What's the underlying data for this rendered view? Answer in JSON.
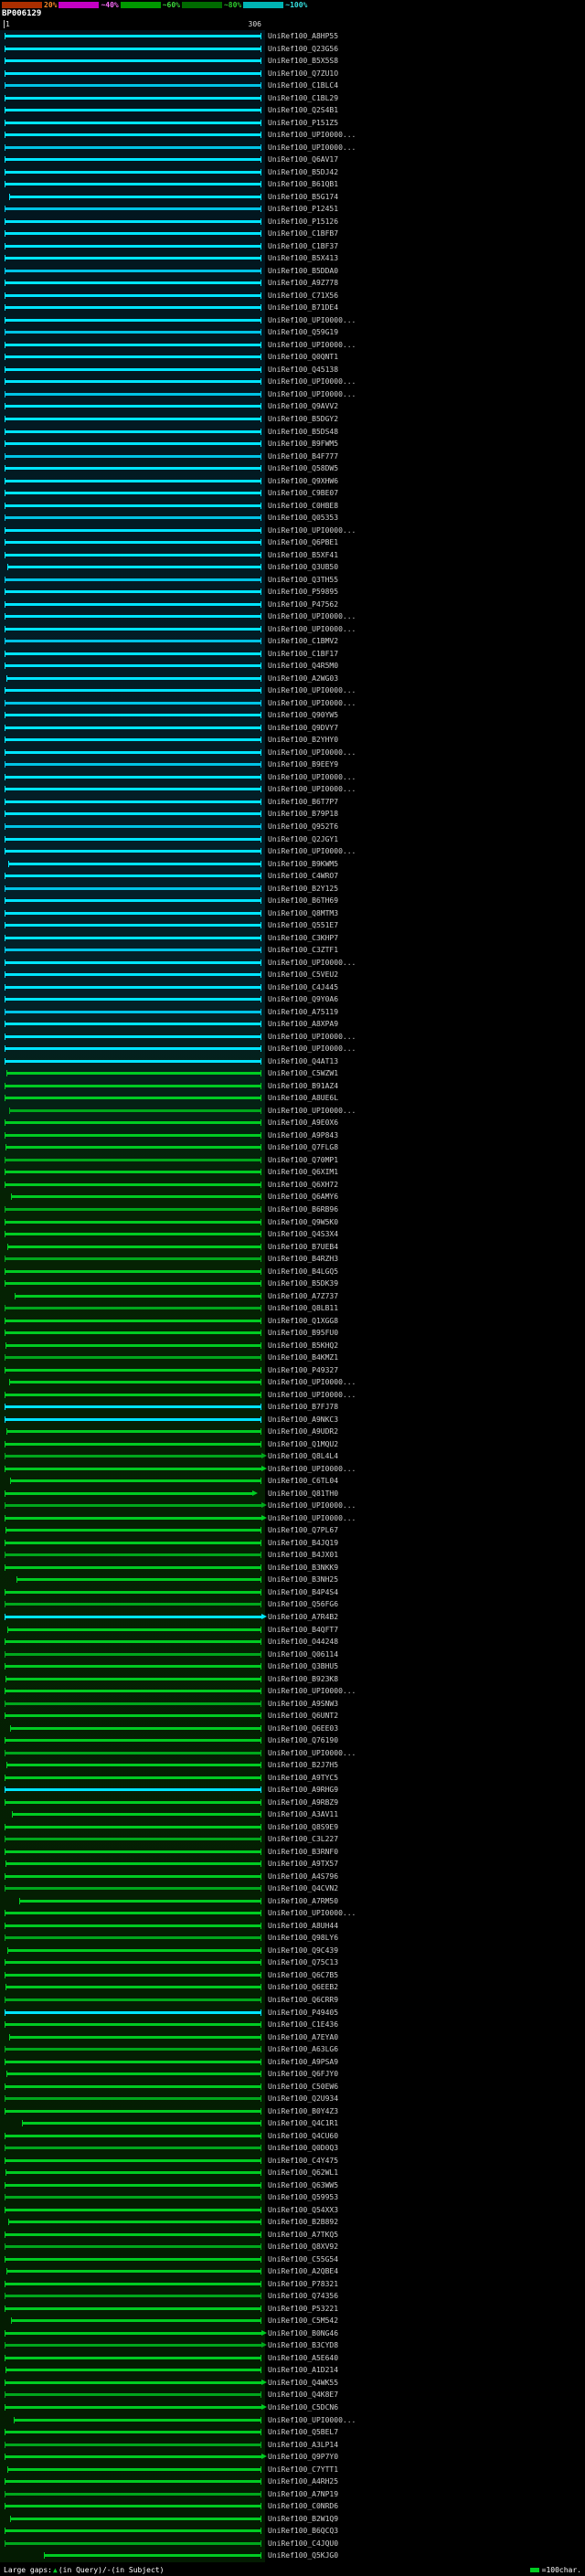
{
  "header": {
    "title": "BP006129"
  },
  "ruler": {
    "start": "1",
    "end": "306"
  },
  "label_prefix": "UniRef100_",
  "colors": {
    "c": "#00e5ff",
    "c2": "#00c4e6",
    "g": "#00cc22",
    "g2": "#00a81c"
  },
  "legend": {
    "gaps_prefix": "Large gaps: ",
    "gaps_triangle": "▲",
    "gaps_suffix": "(in Query)/-(in Subject)",
    "unit_label": "=100char."
  },
  "chart_data": {
    "type": "bar",
    "orientation": "horizontal",
    "title": "BP006129",
    "xlabel": "query position",
    "x_axis": {
      "start": 1,
      "end": 306
    },
    "legend_position": "top",
    "scale_segments": [
      {
        "color": "#aa2e00",
        "label": "20%",
        "label_color": "#ff8a2a"
      },
      {
        "color": "#c400c4",
        "label": "~40%",
        "label_color": "#ff6dff"
      },
      {
        "color": "#009900",
        "label": "~60%",
        "label_color": "#3ddd3d"
      },
      {
        "color": "#006a00",
        "label": "~80%",
        "label_color": "#2ecc2e"
      },
      {
        "color": "#00b4b4",
        "label": "~100%",
        "label_color": "#35e0e0"
      }
    ],
    "rows": [
      [
        "A8HP55",
        "c",
        1,
        306,
        0
      ],
      [
        "Q23G56",
        "c",
        1,
        306,
        0
      ],
      [
        "B5X5S8",
        "c",
        1,
        306,
        0
      ],
      [
        "Q7ZU1O",
        "c",
        1,
        306,
        0
      ],
      [
        "C1BLC4",
        "c2",
        1,
        306,
        0
      ],
      [
        "C1BL29",
        "c",
        1,
        306,
        0
      ],
      [
        "Q2S4B1",
        "c",
        1,
        306,
        0
      ],
      [
        "P151Z5",
        "c",
        1,
        306,
        0
      ],
      [
        "UPI0000...",
        "c",
        1,
        306,
        0
      ],
      [
        "UPI0000...",
        "c2",
        1,
        306,
        0
      ],
      [
        "Q6AV17",
        "c",
        1,
        306,
        0
      ],
      [
        "B5DJ42",
        "c",
        1,
        306,
        0
      ],
      [
        "B61QB1",
        "c",
        1,
        306,
        0
      ],
      [
        "B5G174",
        "c",
        6,
        306,
        0
      ],
      [
        "P12451",
        "c2",
        1,
        306,
        0
      ],
      [
        "P15126",
        "c",
        1,
        306,
        0
      ],
      [
        "C1BFB7",
        "c",
        1,
        306,
        0
      ],
      [
        "C1BF37",
        "c",
        1,
        306,
        0
      ],
      [
        "B5X413",
        "c",
        1,
        306,
        0
      ],
      [
        "B5DDA0",
        "c2",
        1,
        306,
        0
      ],
      [
        "A9Z778",
        "c",
        1,
        306,
        0
      ],
      [
        "C71X56",
        "c",
        1,
        306,
        0
      ],
      [
        "B71DE4",
        "c",
        1,
        306,
        0
      ],
      [
        "UPI0000...",
        "c",
        1,
        306,
        0
      ],
      [
        "Q59G19",
        "c2",
        1,
        306,
        0
      ],
      [
        "UPI0000...",
        "c",
        1,
        306,
        0
      ],
      [
        "Q0QNT1",
        "c",
        1,
        306,
        0
      ],
      [
        "Q45138",
        "c",
        1,
        306,
        0
      ],
      [
        "UPI0000...",
        "c",
        1,
        306,
        0
      ],
      [
        "UPI0000...",
        "c2",
        1,
        306,
        0
      ],
      [
        "Q9AVV2",
        "c",
        1,
        306,
        0
      ],
      [
        "B5DGY2",
        "c",
        1,
        306,
        0
      ],
      [
        "B5DS48",
        "c",
        1,
        306,
        0
      ],
      [
        "B9FWM5",
        "c",
        1,
        306,
        0
      ],
      [
        "B4F777",
        "c2",
        1,
        306,
        0
      ],
      [
        "Q58DW5",
        "c",
        1,
        306,
        0
      ],
      [
        "Q9XHW6",
        "c",
        1,
        306,
        0
      ],
      [
        "C9BE07",
        "c",
        1,
        306,
        0
      ],
      [
        "C0HBE8",
        "c",
        1,
        306,
        0
      ],
      [
        "Q05353",
        "c2",
        1,
        306,
        0
      ],
      [
        "UPI0000...",
        "c",
        1,
        306,
        0
      ],
      [
        "Q6PBE1",
        "c",
        1,
        306,
        0
      ],
      [
        "B5XF41",
        "c",
        1,
        306,
        0
      ],
      [
        "Q3UB50",
        "c",
        4,
        306,
        0
      ],
      [
        "Q3TH55",
        "c2",
        1,
        306,
        0
      ],
      [
        "P59895",
        "c",
        1,
        306,
        0
      ],
      [
        "P47562",
        "c",
        1,
        306,
        0
      ],
      [
        "UPI0000...",
        "c",
        1,
        306,
        0
      ],
      [
        "UPI0000...",
        "c",
        1,
        306,
        0
      ],
      [
        "C1BMV2",
        "c2",
        1,
        306,
        0
      ],
      [
        "C1BF17",
        "c",
        1,
        306,
        0
      ],
      [
        "Q4R5M0",
        "c",
        1,
        306,
        0
      ],
      [
        "A2WG03",
        "c",
        3,
        306,
        0
      ],
      [
        "UPI0000...",
        "c",
        1,
        306,
        0
      ],
      [
        "UPI0000...",
        "c2",
        1,
        306,
        0
      ],
      [
        "Q90YW5",
        "c",
        1,
        306,
        0
      ],
      [
        "Q9DVY7",
        "c",
        1,
        306,
        0
      ],
      [
        "B2YHY0",
        "c",
        1,
        306,
        0
      ],
      [
        "UPI0000...",
        "c",
        1,
        306,
        0
      ],
      [
        "B9EEY9",
        "c2",
        1,
        306,
        0
      ],
      [
        "UPI0000...",
        "c",
        1,
        306,
        0
      ],
      [
        "UPI0000...",
        "c",
        1,
        306,
        0
      ],
      [
        "B6T7P7",
        "c",
        1,
        306,
        0
      ],
      [
        "B79P18",
        "c",
        1,
        306,
        0
      ],
      [
        "Q952T6",
        "c2",
        1,
        306,
        0
      ],
      [
        "Q2JGY1",
        "c",
        1,
        306,
        0
      ],
      [
        "UPI0000...",
        "c",
        1,
        306,
        0
      ],
      [
        "B9KWM5",
        "c",
        5,
        306,
        0
      ],
      [
        "C4WRO7",
        "c",
        1,
        306,
        0
      ],
      [
        "B2Y125",
        "c2",
        1,
        306,
        0
      ],
      [
        "B6TH69",
        "c",
        1,
        306,
        0
      ],
      [
        "Q8MTM3",
        "c",
        1,
        306,
        0
      ],
      [
        "Q551E7",
        "c",
        1,
        306,
        0
      ],
      [
        "C3KHP7",
        "c",
        1,
        306,
        0
      ],
      [
        "C3ZTF1",
        "c2",
        1,
        306,
        0
      ],
      [
        "UPI0000...",
        "c",
        1,
        306,
        0
      ],
      [
        "C5VEU2",
        "c",
        1,
        306,
        0
      ],
      [
        "C4J445",
        "c",
        1,
        306,
        0
      ],
      [
        "Q9Y0A6",
        "c",
        1,
        306,
        0
      ],
      [
        "A75119",
        "c2",
        1,
        306,
        0
      ],
      [
        "A8XPA9",
        "c",
        1,
        306,
        0
      ],
      [
        "UPI0000...",
        "c",
        1,
        306,
        0
      ],
      [
        "UPI0000...",
        "c",
        1,
        306,
        0
      ],
      [
        "Q4AT13",
        "c",
        1,
        306,
        0
      ],
      [
        "C5WZW1",
        "g",
        3,
        306,
        0
      ],
      [
        "B91AZ4",
        "g",
        1,
        306,
        0
      ],
      [
        "A8UE6L",
        "g",
        1,
        306,
        0
      ],
      [
        "UPI0000...",
        "g2",
        6,
        306,
        0
      ],
      [
        "A9E0X6",
        "g",
        1,
        306,
        0
      ],
      [
        "A9P843",
        "g",
        1,
        306,
        0
      ],
      [
        "Q7FLG8",
        "g",
        2,
        306,
        0
      ],
      [
        "Q70MP1",
        "g2",
        1,
        306,
        0
      ],
      [
        "Q6XIM1",
        "g",
        1,
        306,
        0
      ],
      [
        "Q6XH72",
        "g",
        1,
        306,
        0
      ],
      [
        "Q6AMY6",
        "g",
        9,
        306,
        0
      ],
      [
        "B6RB96",
        "g2",
        1,
        306,
        0
      ],
      [
        "Q9W5K0",
        "g",
        1,
        306,
        0
      ],
      [
        "Q4S3X4",
        "g",
        1,
        306,
        0
      ],
      [
        "B7UEB4",
        "g",
        4,
        306,
        0
      ],
      [
        "B4RZH3",
        "g2",
        1,
        306,
        0
      ],
      [
        "B4LGQ5",
        "g",
        1,
        306,
        0
      ],
      [
        "B5DK39",
        "g",
        1,
        306,
        0
      ],
      [
        "A7Z737",
        "g",
        13,
        306,
        0
      ],
      [
        "Q8LB11",
        "g2",
        1,
        306,
        0
      ],
      [
        "Q1XGG8",
        "g",
        1,
        306,
        0
      ],
      [
        "B95FU0",
        "g",
        1,
        306,
        0
      ],
      [
        "B5KHQ2",
        "g",
        2,
        306,
        0
      ],
      [
        "B4KMZ1",
        "g2",
        1,
        306,
        0
      ],
      [
        "P49327",
        "g",
        1,
        306,
        0
      ],
      [
        "UPI0000...",
        "g",
        6,
        306,
        0
      ],
      [
        "UPI0000...",
        "g",
        1,
        306,
        0
      ],
      [
        "B7FJ78",
        "c",
        1,
        306,
        0
      ],
      [
        "A9NKC3",
        "c",
        1,
        306,
        0
      ],
      [
        "A9UDR2",
        "g",
        3,
        306,
        0
      ],
      [
        "Q1MQU2",
        "g",
        1,
        306,
        0
      ],
      [
        "Q8L4L4",
        "g2",
        1,
        306,
        1
      ],
      [
        "UPI0000...",
        "g",
        1,
        306,
        1
      ],
      [
        "C6TL04",
        "g",
        8,
        306,
        0
      ],
      [
        "Q81TH0",
        "g",
        1,
        295,
        1
      ],
      [
        "UPI0000...",
        "g2",
        1,
        306,
        1
      ],
      [
        "UPI0000...",
        "g",
        1,
        306,
        1
      ],
      [
        "Q7PL67",
        "g",
        2,
        306,
        0
      ],
      [
        "B4JQ19",
        "g",
        1,
        306,
        0
      ],
      [
        "B4JX01",
        "g2",
        1,
        306,
        0
      ],
      [
        "B3NKK9",
        "g",
        1,
        306,
        0
      ],
      [
        "B3NH25",
        "g",
        15,
        306,
        0
      ],
      [
        "B4P4S4",
        "g",
        1,
        306,
        0
      ],
      [
        "Q56FG6",
        "g2",
        1,
        306,
        0
      ],
      [
        "A7R4B2",
        "c",
        1,
        306,
        1
      ],
      [
        "B4QFT7",
        "g",
        4,
        306,
        0
      ],
      [
        "O44248",
        "g",
        1,
        306,
        0
      ],
      [
        "Q06114",
        "g2",
        1,
        306,
        0
      ],
      [
        "Q3BHU5",
        "g",
        1,
        306,
        0
      ],
      [
        "B923K8",
        "g",
        2,
        306,
        0
      ],
      [
        "UPI0000...",
        "g",
        1,
        306,
        0
      ],
      [
        "A9SNW3",
        "g2",
        1,
        306,
        0
      ],
      [
        "Q6UNT2",
        "g",
        1,
        306,
        0
      ],
      [
        "Q6EE03",
        "g",
        7,
        306,
        0
      ],
      [
        "Q76190",
        "g",
        1,
        306,
        0
      ],
      [
        "UPI0000...",
        "g2",
        1,
        306,
        0
      ],
      [
        "B2J7H5",
        "g",
        3,
        306,
        0
      ],
      [
        "A9TYC5",
        "g",
        1,
        306,
        0
      ],
      [
        "A9RHG9",
        "c",
        1,
        306,
        0
      ],
      [
        "A9RBZ9",
        "g",
        1,
        306,
        0
      ],
      [
        "A3AV11",
        "g",
        10,
        306,
        0
      ],
      [
        "Q8S9E9",
        "g",
        1,
        306,
        0
      ],
      [
        "C3L227",
        "g2",
        1,
        306,
        0
      ],
      [
        "B3RNF0",
        "g",
        1,
        306,
        0
      ],
      [
        "A9TX57",
        "g",
        2,
        306,
        0
      ],
      [
        "A4S796",
        "g",
        1,
        306,
        0
      ],
      [
        "Q4CVN2",
        "g2",
        1,
        306,
        0
      ],
      [
        "A7RM50",
        "g",
        18,
        306,
        0
      ],
      [
        "UPI0000...",
        "g",
        1,
        306,
        0
      ],
      [
        "A8UH44",
        "g",
        1,
        306,
        0
      ],
      [
        "Q98LY6",
        "g2",
        1,
        306,
        0
      ],
      [
        "Q9C439",
        "g",
        4,
        306,
        0
      ],
      [
        "Q75C13",
        "g",
        1,
        306,
        0
      ],
      [
        "Q6C7B5",
        "g",
        1,
        306,
        0
      ],
      [
        "Q6EEB2",
        "g",
        2,
        306,
        0
      ],
      [
        "Q6CRR9",
        "g2",
        1,
        306,
        0
      ],
      [
        "P49405",
        "c",
        1,
        306,
        0
      ],
      [
        "C1E436",
        "g",
        1,
        306,
        0
      ],
      [
        "A7EYA0",
        "g",
        6,
        306,
        0
      ],
      [
        "A63LG6",
        "g2",
        1,
        306,
        0
      ],
      [
        "A9PSA9",
        "g",
        1,
        306,
        0
      ],
      [
        "Q6FJY0",
        "g",
        3,
        306,
        0
      ],
      [
        "C50EW6",
        "g",
        1,
        306,
        0
      ],
      [
        "Q2U934",
        "g2",
        1,
        306,
        0
      ],
      [
        "B0Y4Z3",
        "g",
        1,
        306,
        0
      ],
      [
        "Q4C1R1",
        "g",
        22,
        306,
        0
      ],
      [
        "Q4CU60",
        "g",
        1,
        306,
        0
      ],
      [
        "Q0D0Q3",
        "g2",
        1,
        306,
        0
      ],
      [
        "C4Y475",
        "g",
        1,
        306,
        0
      ],
      [
        "Q62WL1",
        "g",
        2,
        306,
        0
      ],
      [
        "Q63WW5",
        "g",
        1,
        306,
        0
      ],
      [
        "Q59953",
        "g2",
        1,
        306,
        0
      ],
      [
        "Q54XX3",
        "g",
        1,
        306,
        0
      ],
      [
        "B2B892",
        "g",
        5,
        306,
        0
      ],
      [
        "A7TKQ5",
        "g",
        1,
        306,
        0
      ],
      [
        "Q8XV92",
        "g2",
        1,
        306,
        0
      ],
      [
        "C55G54",
        "g",
        1,
        306,
        0
      ],
      [
        "A2QBE4",
        "g",
        3,
        306,
        0
      ],
      [
        "P78321",
        "g",
        1,
        306,
        0
      ],
      [
        "Q74356",
        "g2",
        1,
        306,
        0
      ],
      [
        "P53221",
        "g",
        1,
        306,
        0
      ],
      [
        "C5M542",
        "g",
        9,
        306,
        0
      ],
      [
        "B0NG46",
        "g",
        1,
        306,
        1
      ],
      [
        "B3CYD8",
        "g2",
        1,
        306,
        1
      ],
      [
        "A5E640",
        "g",
        1,
        306,
        0
      ],
      [
        "A1D214",
        "g",
        2,
        306,
        0
      ],
      [
        "Q4WK55",
        "g",
        1,
        306,
        1
      ],
      [
        "Q4K8E7",
        "g2",
        1,
        306,
        0
      ],
      [
        "C5DCN6",
        "g",
        1,
        306,
        1
      ],
      [
        "UPI0000...",
        "g",
        12,
        306,
        0
      ],
      [
        "Q5BEL7",
        "g",
        1,
        306,
        0
      ],
      [
        "A3LP14",
        "g2",
        1,
        306,
        0
      ],
      [
        "Q9P7Y0",
        "g",
        1,
        306,
        1
      ],
      [
        "C7YTT1",
        "g",
        4,
        306,
        0
      ],
      [
        "A4RH25",
        "g",
        1,
        306,
        0
      ],
      [
        "A7NP19",
        "g2",
        1,
        306,
        0
      ],
      [
        "C0NRD6",
        "g",
        1,
        306,
        0
      ],
      [
        "B2W1Q9",
        "g",
        7,
        306,
        0
      ],
      [
        "B6QCQ3",
        "g",
        1,
        306,
        0
      ],
      [
        "C4JQU0",
        "g2",
        1,
        306,
        0
      ],
      [
        "Q5KJG0",
        "g",
        48,
        306,
        0
      ]
    ]
  }
}
